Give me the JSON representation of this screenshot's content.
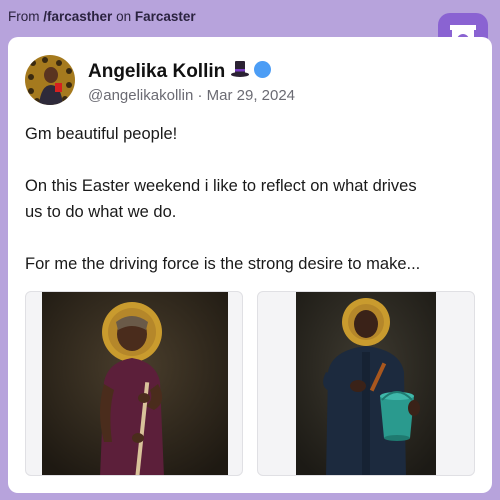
{
  "source": {
    "prefix": "From",
    "channel": "/farcasther",
    "connector": "on",
    "platform": "Farcaster"
  },
  "post": {
    "author_name": "Angelika Kollin",
    "handle": "@angelikakollin",
    "separator": "·",
    "date": "Mar 29, 2024",
    "lines": [
      "Gm beautiful people!",
      "On this Easter weekend i like to reflect on what drives",
      "us to do what we do.",
      "For me the driving force is the strong desire to make..."
    ]
  },
  "icons": {
    "app_logo": "farcaster-arch-icon",
    "author_badge": "top-hat-icon",
    "verified": "verified-badge-icon"
  },
  "colors": {
    "page_background": "#b7a3dc",
    "brand": "#8a63d2",
    "verified": "#4c9df5",
    "handle_text": "#6b6b73"
  }
}
